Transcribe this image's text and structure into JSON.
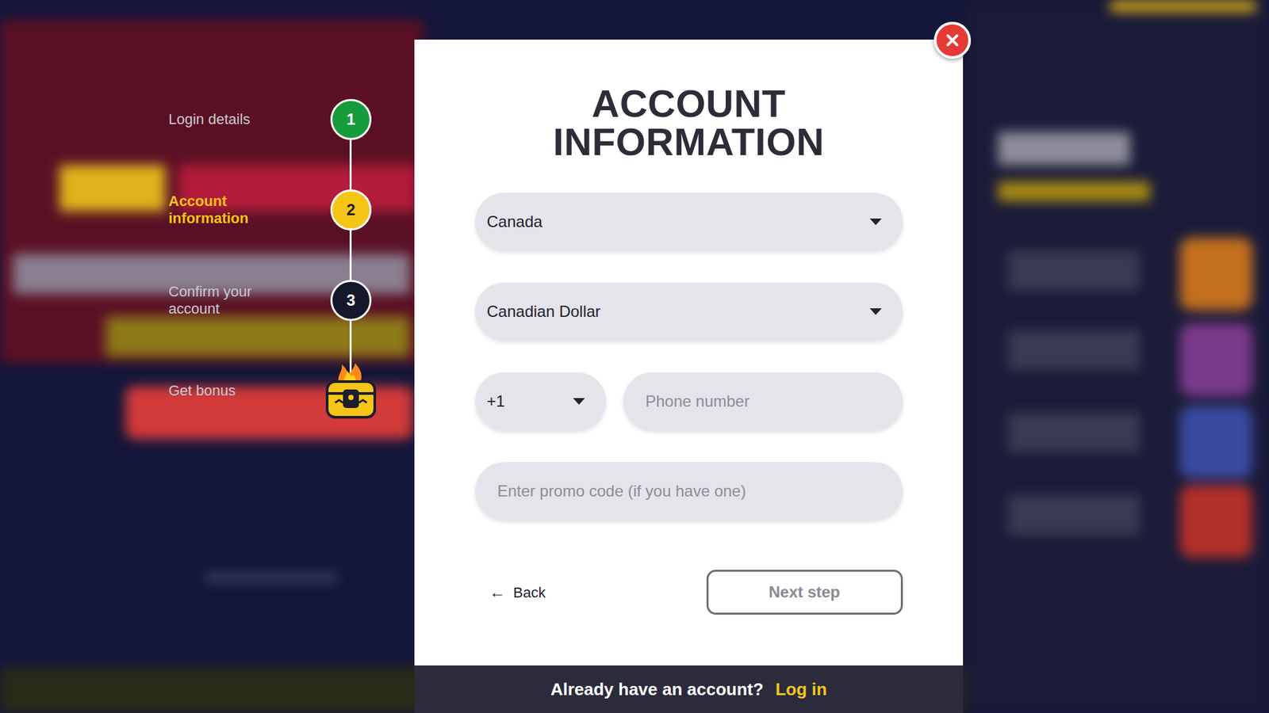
{
  "stepper": {
    "steps": [
      {
        "label": "Login details",
        "number": "1",
        "kind": "number",
        "state": "done"
      },
      {
        "label": "Account information",
        "number": "2",
        "kind": "number",
        "state": "current"
      },
      {
        "label": "Confirm your account",
        "number": "3",
        "kind": "number",
        "state": "pending"
      },
      {
        "label": "Get bonus",
        "kind": "chest",
        "state": "pending"
      }
    ]
  },
  "modal": {
    "title": "ACCOUNT INFORMATION",
    "country": {
      "value": "Canada"
    },
    "currency": {
      "value": "Canadian Dollar"
    },
    "phone": {
      "code": "+1",
      "placeholder": "Phone number"
    },
    "promo": {
      "placeholder": "Enter promo code (if you have one)"
    },
    "back": {
      "arrow": "←",
      "label": "Back"
    },
    "next": {
      "label": "Next step",
      "disabled": true
    },
    "footer": {
      "question": "Already have an account?",
      "link": "Log in"
    }
  }
}
